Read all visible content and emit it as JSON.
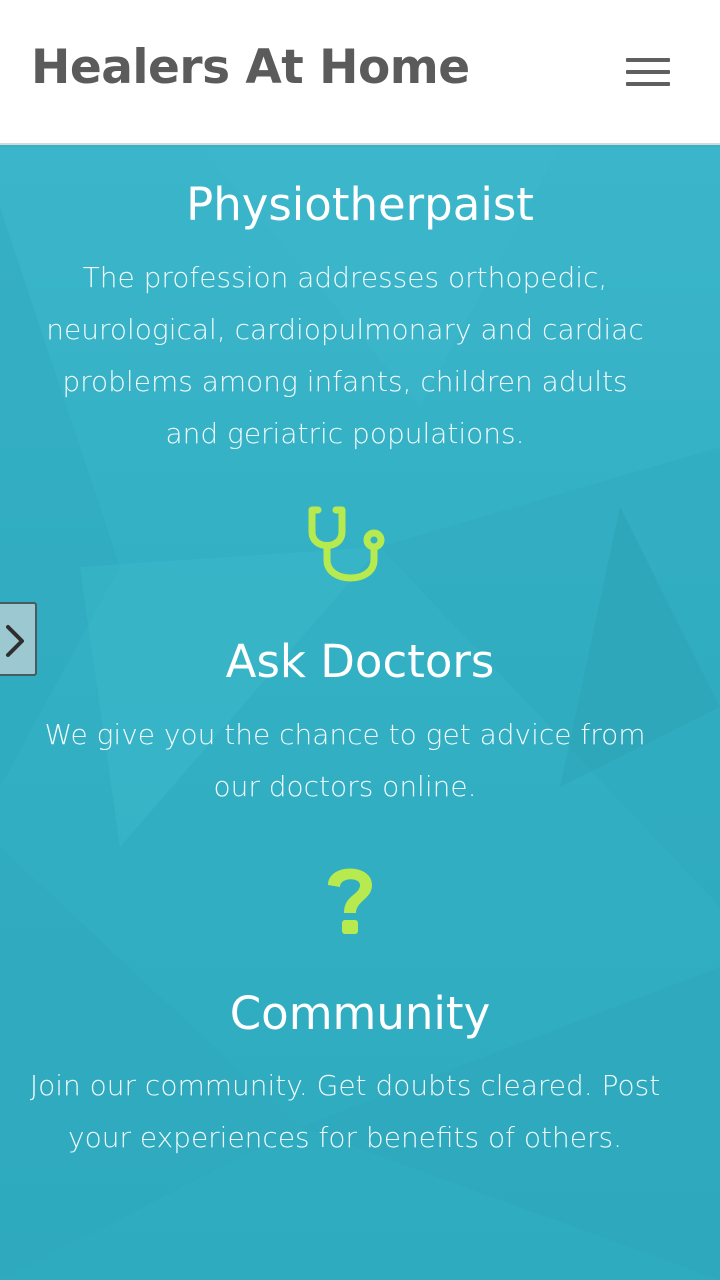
{
  "header": {
    "brand": "Healers At Home",
    "menu_icon": "hamburger-menu-icon"
  },
  "side_nav": {
    "icon": "chevron-right-icon"
  },
  "features": [
    {
      "title": "Physiotherpaist",
      "description": "The profession addresses orthopedic, neurological, cardiopulmonary and cardiac problems among infants, children adults and geriatric populations."
    },
    {
      "icon": "stethoscope-icon",
      "title": "Ask Doctors",
      "description": "We give you the chance to get advice from our doctors online."
    },
    {
      "icon": "question-mark-icon",
      "title": "Community",
      "description": "Join our community. Get doubts cleared. Post your experiences for benefits of others."
    }
  ],
  "colors": {
    "background": "#36b2c6",
    "accent": "#b6ea4f",
    "header_text": "#5b5b5b"
  }
}
